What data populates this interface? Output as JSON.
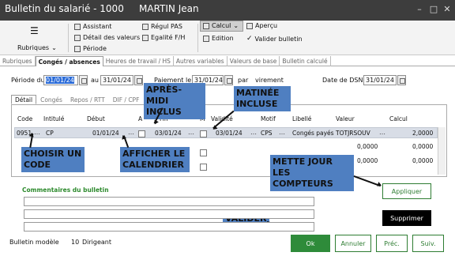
{
  "window": {
    "title": "Bulletin du salarié - 1000",
    "employee": "MARTIN Jean"
  },
  "ribbon": {
    "rubriques": "Rubriques",
    "assistant": "Assistant",
    "detail_valeurs": "Détail des valeurs",
    "periode": "Période",
    "regul_pas": "Régul PAS",
    "egalite": "Egalité F/H",
    "calcul": "Calcul",
    "edition": "Edition",
    "apercu": "Aperçu",
    "valider_bulletin": "Valider bulletin"
  },
  "main_tabs": [
    "Rubriques",
    "Congés / absences",
    "Heures de travail / HS",
    "Autres variables",
    "Valeurs de base",
    "Bulletin calculé"
  ],
  "period": {
    "label": "Période du",
    "from": "01/01/24",
    "to_label": "au",
    "to": "31/01/24",
    "paiement_label": "Paiement le",
    "paiement_date": "31/01/24",
    "par_label": "par",
    "par_value": "virement",
    "dsn_label": "Date de DSN",
    "dsn_date": "31/01/24"
  },
  "sub_tabs": [
    "Détail",
    "Congés",
    "Repos / RTT",
    "DIF / CPF"
  ],
  "table": {
    "headers": {
      "code": "Code",
      "intitule": "Intitulé",
      "debut": "Début",
      "a": "A",
      "fin": "Fin",
      "m": "M",
      "validite": "Validité",
      "motif": "Motif",
      "libelle": "Libellé",
      "valeur": "Valeur",
      "calcul": "Calcul"
    },
    "row1": {
      "code": "0951",
      "intitule": "CP",
      "debut": "01/01/24",
      "fin": "03/01/24",
      "validite": "03/01/24",
      "motif": "CPS",
      "libelle": "Congés payés",
      "valeur": "TOTJRSOUV",
      "calcul": "2,0000"
    },
    "row2": {
      "calcul": "0,0000",
      "calcul_left": "0,0000"
    },
    "row3": {
      "calcul": "0,0000",
      "calcul_left": "0,0000"
    }
  },
  "callouts": {
    "apres_midi": "APRÈS-MIDI INCLUS",
    "matinee": "MATINÉE INCLUSE",
    "choisir": "CHOISIR UN CODE",
    "afficher": "AFFICHER LE CALENDRIER",
    "mettre": "METTE JOUR LES COMPTEURS",
    "valider": "VALIDER"
  },
  "comments": {
    "title": "Commentaires du bulletin"
  },
  "footer": {
    "modele_label": "Bulletin modèle",
    "modele_code": "10",
    "modele_name": "Dirigeant"
  },
  "buttons": {
    "appliquer": "Appliquer",
    "supprimer": "Supprimer",
    "ok": "Ok",
    "annuler": "Annuler",
    "prec": "Préc.",
    "suiv": "Suiv."
  }
}
